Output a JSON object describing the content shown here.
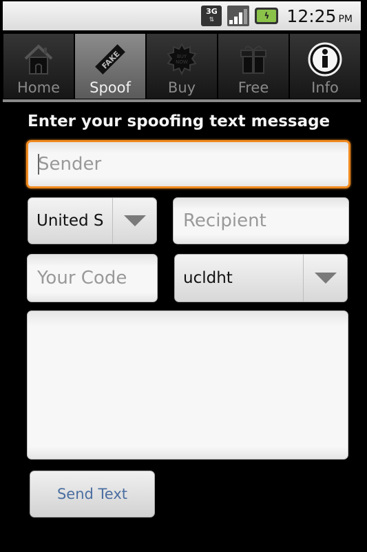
{
  "status_bar": {
    "network_type": "3G",
    "signal_icon": "signal-bars-icon",
    "battery_icon": "battery-charging-icon",
    "time": "12:25",
    "ampm": "PM"
  },
  "tabs": [
    {
      "label": "Home",
      "icon": "house-icon",
      "active": false
    },
    {
      "label": "Spoof",
      "icon": "fake-stamp-icon",
      "active": true
    },
    {
      "label": "Buy",
      "icon": "buy-now-badge-icon",
      "active": false
    },
    {
      "label": "Free",
      "icon": "gift-icon",
      "active": false
    },
    {
      "label": "Info",
      "icon": "info-icon",
      "active": false
    }
  ],
  "form": {
    "heading": "Enter your spoofing text message",
    "sender_placeholder": "Sender",
    "country_value": "United S",
    "recipient_placeholder": "Recipient",
    "code_placeholder": "Your Code",
    "code_select_value": "ucldht",
    "message_value": "",
    "send_label": "Send Text"
  },
  "colors": {
    "focus_accent": "#f08a1e",
    "send_text": "#4a6ea0"
  }
}
